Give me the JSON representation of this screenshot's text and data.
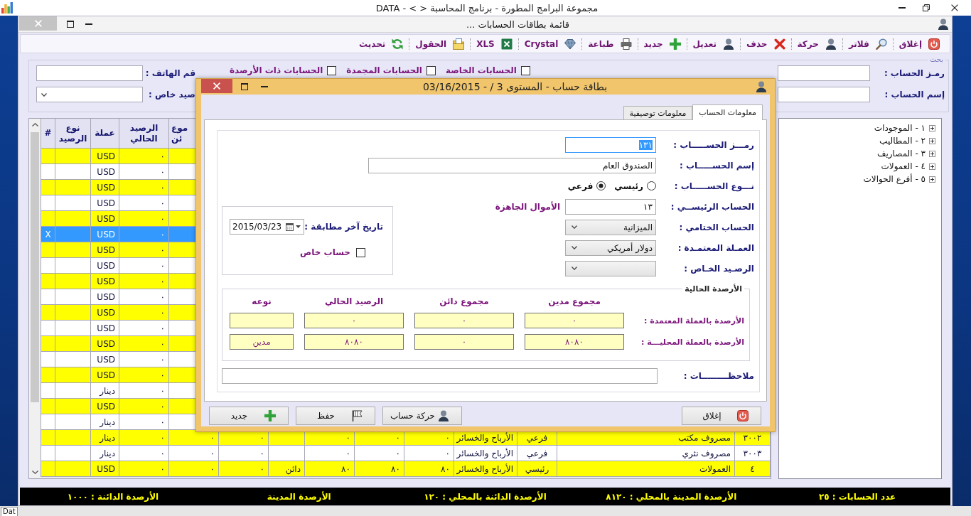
{
  "app_window": {
    "title": "مجموعة البرامج المطورة - برنامج المحاسبة <  > - DATA"
  },
  "list_window": {
    "title": "قائمة بطاقات الحسابات ...",
    "toolbar": [
      "إغلاق",
      "فلاتر",
      "حركة",
      "حذف",
      "تعديل",
      "جديد",
      "طباعة",
      "Crystal",
      "XLS",
      "الحقول",
      "تحديث"
    ],
    "search": {
      "legend": "بحث",
      "account_code": {
        "label": "رمـز الحساب :"
      },
      "account_name": {
        "label": "إسم الحساب :"
      },
      "filters": [
        {
          "label": "الحسابات الخاصة",
          "checked": false
        },
        {
          "label": "الحسابات المجمدة",
          "checked": false
        },
        {
          "label": "الحسابات ذات الأرصدة",
          "checked": false
        }
      ],
      "phone": {
        "label": "قم الهاتف :"
      },
      "special_balance": {
        "label": "صيد خاص :"
      }
    },
    "grid": {
      "columns": {
        "column_10": "موع ئن",
        "column_11": "الرصيد الحالي",
        "column_12": "عملة",
        "column_13": "نوع الرصيد",
        "column_14": "#"
      },
      "rows": [
        {
          "selected": false,
          "cells": {
            "column_11": "٠",
            "column_12": "USD"
          }
        },
        {
          "selected": false,
          "cells": {
            "column_11": "٠",
            "column_12": "USD"
          }
        },
        {
          "selected": false,
          "cells": {
            "column_11": "٠",
            "column_12": "USD"
          }
        },
        {
          "selected": false,
          "cells": {
            "column_11": "٠",
            "column_12": "USD"
          }
        },
        {
          "selected": false,
          "cells": {
            "column_11": "٠",
            "column_12": "USD"
          }
        },
        {
          "selected": true,
          "cells": {
            "column_11": "٠",
            "column_12": "USD",
            "column_14": "X"
          }
        },
        {
          "selected": false,
          "cells": {
            "column_11": "٠",
            "column_12": "USD"
          }
        },
        {
          "selected": false,
          "cells": {
            "column_11": "٠",
            "column_12": "USD"
          }
        },
        {
          "selected": false,
          "cells": {
            "column_11": "٠",
            "column_12": "USD"
          }
        },
        {
          "selected": false,
          "cells": {
            "column_11": "٠",
            "column_12": "USD"
          }
        },
        {
          "selected": false,
          "cells": {
            "column_11": "٠",
            "column_12": "USD"
          }
        },
        {
          "selected": false,
          "cells": {
            "column_11": "٠",
            "column_12": "USD"
          }
        },
        {
          "selected": false,
          "cells": {
            "column_11": "٠",
            "column_12": "USD"
          }
        },
        {
          "selected": false,
          "cells": {
            "column_11": "٠",
            "column_12": "USD"
          }
        },
        {
          "selected": false,
          "cells": {
            "column_11": "٠",
            "column_12": "USD"
          }
        },
        {
          "selected": false,
          "cells": {
            "column_11": "٠",
            "column_12": "دينار"
          }
        },
        {
          "selected": false,
          "cells": {
            "column_11": "٠",
            "column_12": "USD"
          }
        },
        {
          "selected": false,
          "cells": {
            "column_11": "٠",
            "column_12": "دينار"
          }
        },
        {
          "selected": false,
          "cells": {
            "column_1": "٣٠٠٢",
            "column_2": "مصروف مكتب",
            "column_3": "فرعي",
            "column_4": "الأرباح والخسائر",
            "column_5": "٠",
            "column_6": "٠",
            "column_7": "٠",
            "column_9": "٠",
            "column_10": "٠",
            "column_11": "٠",
            "column_12": "دينار"
          }
        },
        {
          "selected": false,
          "cells": {
            "column_1": "٣٠٠٣",
            "column_2": "مصروف نثري",
            "column_3": "فرعي",
            "column_4": "الأرباح والخسائر",
            "column_5": "٠",
            "column_6": "٠",
            "column_7": "٠",
            "column_9": "٠",
            "column_10": "٠",
            "column_11": "٠",
            "column_12": "دينار"
          }
        },
        {
          "selected": false,
          "cells": {
            "column_1": "٤",
            "column_2": "العمولات",
            "column_3": "رئيسي",
            "column_4": "الأرباح والخسائر",
            "column_5": "٨٠",
            "column_6": "٨٠",
            "column_7": "٨٠",
            "column_8": "دائن",
            "column_9": "٠",
            "column_10": "٠",
            "column_11": "٠",
            "column_12": "USD"
          }
        }
      ]
    },
    "tree": [
      {
        "label": "١ - الموجودات",
        "expanded": false
      },
      {
        "label": "٢ - المطاليب",
        "expanded": false
      },
      {
        "label": "٣ - المصاريف",
        "expanded": false
      },
      {
        "label": "٤ - العمولات",
        "expanded": false
      },
      {
        "label": "٥ - أفرع الحوالات",
        "expanded": false
      }
    ],
    "status_bar": [
      "عدد الحسابات : ٢٥",
      "الأرصدة المدينة بالمحلي : ٨١٢٠",
      "الأرصدة الدائنة بالمحلي : ١٢٠",
      "الأرصدة المدينة",
      "الأرصدة الدائنة : ١٠٠٠"
    ]
  },
  "dialog": {
    "title": "بطاقة حساب - المستوى 3 /  - 03/16/2015",
    "tabs": [
      {
        "label": "معلومات الحساب",
        "selected": true
      },
      {
        "label": "معلومات توصيفية",
        "selected": false
      }
    ],
    "account_code": {
      "label": "رمـــز الحســـــاب :",
      "value": "١٣١",
      "focused": true
    },
    "account_name": {
      "label": "إسم الحســـــاب :",
      "value": "الصندوق العام"
    },
    "account_type": {
      "label": "نـــوع الحســـــاب :",
      "options": [
        {
          "label": "رئيسي",
          "selected": false
        },
        {
          "label": "فرعي",
          "selected": true
        }
      ]
    },
    "parent_account": {
      "label": "الحساب الرئيســي :",
      "value": "١٣",
      "name": "الأموال الجاهزة"
    },
    "final_account": {
      "label": "الحساب الختامي :",
      "value": "الميزانية"
    },
    "currency": {
      "label": "العمـلة المعتمـدة :",
      "value": "دولار أمريكي"
    },
    "special_balance": {
      "label": "الرصـيد الخـاص :"
    },
    "last_reconciliation": {
      "label": "تاريخ آخر مطابقة :",
      "value": "2015/03/23"
    },
    "special_account": {
      "label": "حساب خاص",
      "checked": false
    },
    "balances": {
      "legend": "الأرصدة الحالية",
      "columns": [
        "مجموع مدين",
        "مجموع دائن",
        "الرصيد الحالي",
        "نوعه"
      ],
      "rows": [
        {
          "label": "الأرصدة بالعملة المعتمدة :",
          "values": [
            "٠",
            "٠",
            "٠"
          ]
        },
        {
          "label": "الأرصدة بالعملة المحليـــة :",
          "values": [
            "٨٠٨٠",
            "٠",
            "٨٠٨٠",
            "مدين"
          ]
        }
      ]
    },
    "notes": {
      "label": "ملاحظـــــــــات :"
    },
    "buttons": [
      "إغلاق",
      "حركة حساب",
      "حفظ",
      "جديد"
    ]
  },
  "taskbar": [
    "Dat"
  ]
}
